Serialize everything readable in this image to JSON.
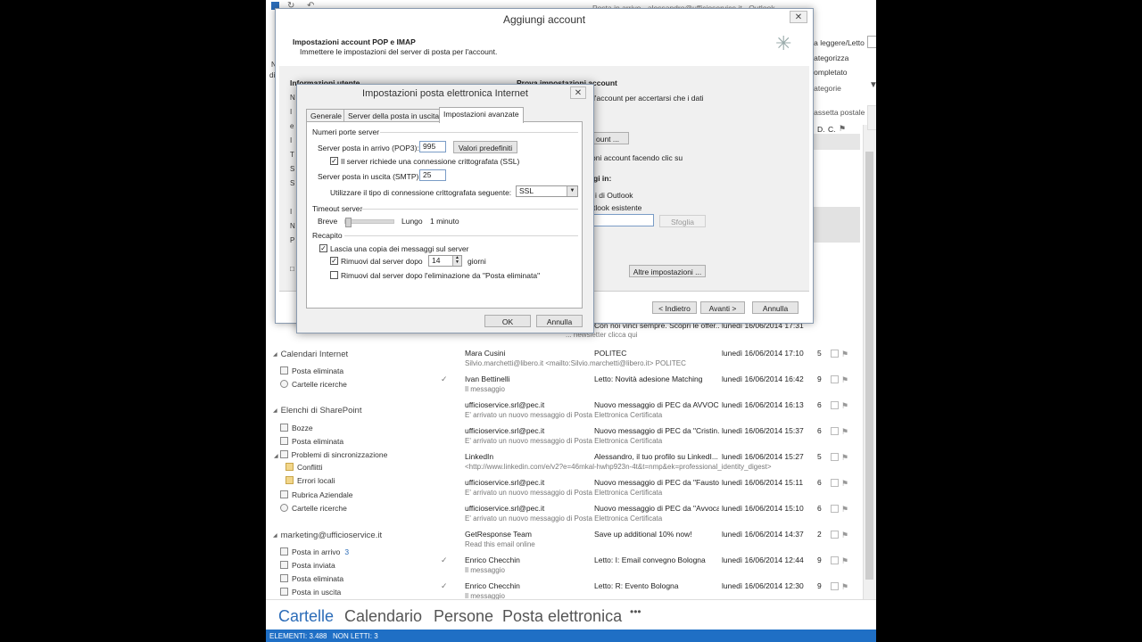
{
  "outlook": {
    "titlebar": "Posta in arrivo - alessandro@ufficioservice.it - Outlook",
    "ribbon": {
      "leggere_letto": "Da leggere/Letto",
      "categorizza": "Categorizza",
      "completato": "Completato",
      "categorie": "Categorie",
      "cerca_cassetta": "Cassetta postale corrente",
      "col_d": "D.",
      "col_c": "C."
    },
    "folders": {
      "calendari_internet": "Calendari Internet",
      "ci_items": [
        "Posta eliminata",
        "Cartelle ricerche"
      ],
      "elenchi_sharepoint": "Elenchi di SharePoint",
      "sp_items": [
        "Bozze",
        "Posta eliminata",
        "Problemi di sincronizzazione",
        "Conflitti",
        "Errori locali",
        "Rubrica Aziendale",
        "Cartelle ricerche"
      ],
      "account": "marketing@ufficioservice.it",
      "acc_items": [
        {
          "label": "Posta in arrivo",
          "count": "3"
        },
        {
          "label": "Posta inviata",
          "count": ""
        },
        {
          "label": "Posta eliminata",
          "count": ""
        },
        {
          "label": "Posta in uscita",
          "count": ""
        }
      ]
    },
    "mails": [
      {
        "sender": "Mara Cusini",
        "subject": "POLITEC",
        "date": "lunedì 16/06/2014 17:10",
        "size": "5",
        "preview": "Silvio.marchetti@libero.it <mailto:Silvio.marchetti@libero.it>   POLITEC",
        "icon": ""
      },
      {
        "sender": "Ivan Bettinelli",
        "subject": "Letto: Novità adesione Matching",
        "date": "lunedì 16/06/2014 16:42",
        "size": "9",
        "preview": "Il messaggio",
        "icon": "✓"
      },
      {
        "sender": "ufficioservice.srl@pec.it",
        "subject": "Nuovo messaggio di PEC da AVVOC...",
        "date": "lunedì 16/06/2014 16:13",
        "size": "6",
        "preview": "E' arrivato un nuovo messaggio di Posta Elettronica Certificata",
        "icon": ""
      },
      {
        "sender": "ufficioservice.srl@pec.it",
        "subject": "Nuovo messaggio di PEC da \"Cristin...",
        "date": "lunedì 16/06/2014 15:37",
        "size": "6",
        "preview": "E' arrivato un nuovo messaggio di Posta Elettronica Certificata",
        "icon": ""
      },
      {
        "sender": "LinkedIn",
        "subject": "Alessandro, il tuo profilo su LinkedI...",
        "date": "lunedì 16/06/2014 15:27",
        "size": "5",
        "preview": "<http://www.linkedin.com/e/v2?e=46mkal-hwhp923n-4t&t=nmp&ek=professional_identity_digest>",
        "icon": ""
      },
      {
        "sender": "ufficioservice.srl@pec.it",
        "subject": "Nuovo messaggio di PEC da \"Fausto...",
        "date": "lunedì 16/06/2014 15:11",
        "size": "6",
        "preview": "E' arrivato un nuovo messaggio di Posta Elettronica Certificata",
        "icon": ""
      },
      {
        "sender": "ufficioservice.srl@pec.it",
        "subject": "Nuovo messaggio di PEC da \"Avvoca...",
        "date": "lunedì 16/06/2014 15:10",
        "size": "6",
        "preview": "E' arrivato un nuovo messaggio di Posta Elettronica Certificata",
        "icon": ""
      },
      {
        "sender": "GetResponse Team",
        "subject": "Save up additional 10% now!",
        "date": "lunedì 16/06/2014 14:37",
        "size": "2",
        "preview": "Read this email online",
        "icon": ""
      },
      {
        "sender": "Enrico Checchin",
        "subject": "Letto: I: Email convegno Bologna",
        "date": "lunedì 16/06/2014 12:44",
        "size": "9",
        "preview": "Il messaggio",
        "icon": "✓"
      },
      {
        "sender": "Enrico Checchin",
        "subject": "Letto: R: Evento Bologna",
        "date": "lunedì 16/06/2014 12:30",
        "size": "9",
        "preview": "Il messaggio",
        "icon": "✓"
      }
    ],
    "partial_row": {
      "subject": "Con noi vinci sempre. Scopri le offer...",
      "date": "lunedì 16/06/2014 17:31",
      "preview": "... newsletter clicca qui"
    },
    "navbar": [
      "Cartelle",
      "Calendario",
      "Persone",
      "Posta elettronica",
      "•••"
    ],
    "status": {
      "elementi": "ELEMENTI: 3.488",
      "non_letti": "NON LETTI: 3"
    }
  },
  "add_account": {
    "title": "Aggiungi account",
    "header_title": "Impostazioni account POP e IMAP",
    "header_sub": "Immettere le impostazioni del server di posta per l'account.",
    "info_utente": "Informazioni utente",
    "prova_impostazioni": "Prova impostazioni account",
    "prova_text": "l'account per accertarsi che i dati",
    "account_btn": "ount ...",
    "prova_text2": "oni account facendo clic su",
    "recapita_in": "gi in:",
    "opt_outlook": "i di Outlook",
    "opt_esistente": "tlook esistente",
    "sfoglia": "Sfoglia",
    "altre_impostazioni": "Altre impostazioni ...",
    "indietro": "< Indietro",
    "avanti": "Avanti >",
    "annulla": "Annulla"
  },
  "internet_settings": {
    "title": "Impostazioni posta elettronica Internet",
    "tabs": [
      "Generale",
      "Server della posta in uscita",
      "Impostazioni avanzate"
    ],
    "numeri_porte": "Numeri porte server",
    "pop3_label": "Server posta in arrivo (POP3):",
    "pop3_value": "995",
    "valori_predefiniti": "Valori predefiniti",
    "ssl_label": "Il server richiede una connessione crittografata (SSL)",
    "smtp_label": "Server posta in uscita (SMTP):",
    "smtp_value": "25",
    "enc_label": "Utilizzare il tipo di connessione crittografata seguente:",
    "enc_value": "SSL",
    "timeout_label": "Timeout server",
    "breve": "Breve",
    "lungo": "Lungo",
    "timeout_value": "1 minuto",
    "timeout_level": 0,
    "recapito": "Recapito",
    "lascia_copia": "Lascia una copia dei messaggi sul server",
    "rimuovi_dopo": "Rimuovi dal server dopo",
    "giorni_value": "14",
    "giorni": "giorni",
    "rimuovi_eliminata": "Rimuovi dal server dopo l'eliminazione da \"Posta eliminata\"",
    "ok": "OK",
    "annulla": "Annulla"
  }
}
